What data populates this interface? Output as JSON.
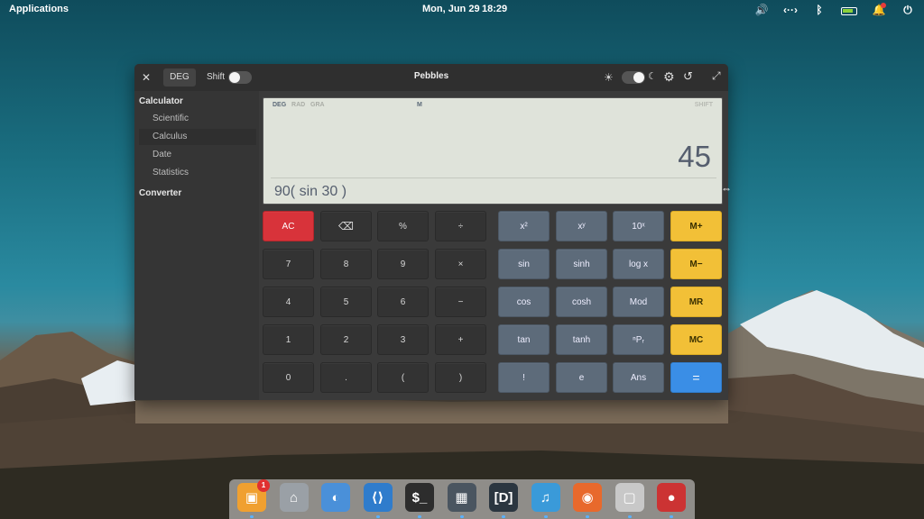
{
  "topbar": {
    "applications": "Applications",
    "date": "Mon, Jun 29",
    "time": "18:29",
    "tray_icons": [
      "volume-icon",
      "network-icon",
      "bluetooth-icon",
      "battery-icon",
      "notifications-icon",
      "power-icon"
    ]
  },
  "window": {
    "title": "Pebbles",
    "angle_button": "DEG",
    "shift_label": "Shift",
    "colors": {
      "ac": "#d8333a",
      "memory": "#f2c037",
      "equals": "#3a8ee6",
      "scientific": "#5d6b7a"
    }
  },
  "sidebar": {
    "calculator_heading": "Calculator",
    "items": [
      "Scientific",
      "Calculus",
      "Date",
      "Statistics"
    ],
    "active_item": "Calculus",
    "converter_heading": "Converter"
  },
  "display": {
    "modes": [
      "DEG",
      "RAD",
      "GRA"
    ],
    "active_mode": "DEG",
    "memory_indicator": "M",
    "shift_indicator": "SHIFT",
    "result": "45",
    "expression": "90( sin 30 )"
  },
  "keypad": {
    "basic": [
      [
        "AC",
        "",
        "%",
        "÷"
      ],
      [
        "7",
        "8",
        "9",
        "×"
      ],
      [
        "4",
        "5",
        "6",
        "−"
      ],
      [
        "1",
        "2",
        "3",
        "+"
      ],
      [
        "0",
        ".",
        "(",
        ")"
      ]
    ],
    "scientific": [
      [
        "x²",
        "xʸ",
        "10ˣ",
        "M+"
      ],
      [
        "sin",
        "sinh",
        "log x",
        "M−"
      ],
      [
        "cos",
        "cosh",
        "Mod",
        "MR"
      ],
      [
        "tan",
        "tanh",
        "ⁿPᵣ",
        "MC"
      ],
      [
        "!",
        "e",
        "Ans",
        "="
      ]
    ]
  },
  "dock": {
    "apps": [
      "appcenter-icon",
      "files-icon",
      "settings-icon",
      "vscode-icon",
      "terminal-icon",
      "pebbles-icon",
      "code-editor-icon",
      "music-icon",
      "firefox-icon",
      "sandbox-icon",
      "screen-recorder-icon"
    ],
    "badge_count": "1"
  }
}
